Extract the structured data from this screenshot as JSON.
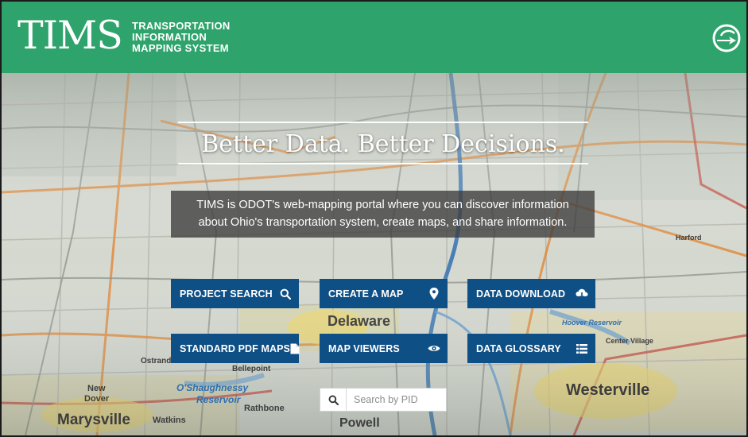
{
  "header": {
    "logo_text": "TIMS",
    "logo_subtitle_lines": [
      "TRANSPORTATION",
      "INFORMATION",
      "MAPPING SYSTEM"
    ],
    "odot_icon": "odot-logo-icon",
    "brand_color": "#2ea36b"
  },
  "hero": {
    "title": "Better Data. Better Decisions.",
    "description_lines": [
      "TIMS is ODOT's web-mapping portal where you can discover information",
      "about Ohio's transportation system, create maps, and share information."
    ]
  },
  "buttons": [
    {
      "label": "PROJECT SEARCH",
      "icon": "search-icon"
    },
    {
      "label": "CREATE A MAP",
      "icon": "map-pin-icon"
    },
    {
      "label": "DATA DOWNLOAD",
      "icon": "cloud-download-icon"
    },
    {
      "label": "STANDARD PDF MAPS",
      "icon": "document-icon"
    },
    {
      "label": "MAP VIEWERS",
      "icon": "eye-icon"
    },
    {
      "label": "DATA GLOSSARY",
      "icon": "list-icon"
    }
  ],
  "button_color": "#0e4f85",
  "search": {
    "placeholder": "Search by PID",
    "value": "",
    "icon": "search-icon"
  },
  "map_labels": [
    "Marysville",
    "Delaware",
    "Westerville",
    "O'Shaughnessy",
    "Reservoir",
    "New",
    "Dover",
    "Watkins",
    "Rathbone",
    "Powell",
    "Ostrander",
    "Bellepoint",
    "Center Village",
    "Hoover Reservoir",
    "Harford"
  ]
}
